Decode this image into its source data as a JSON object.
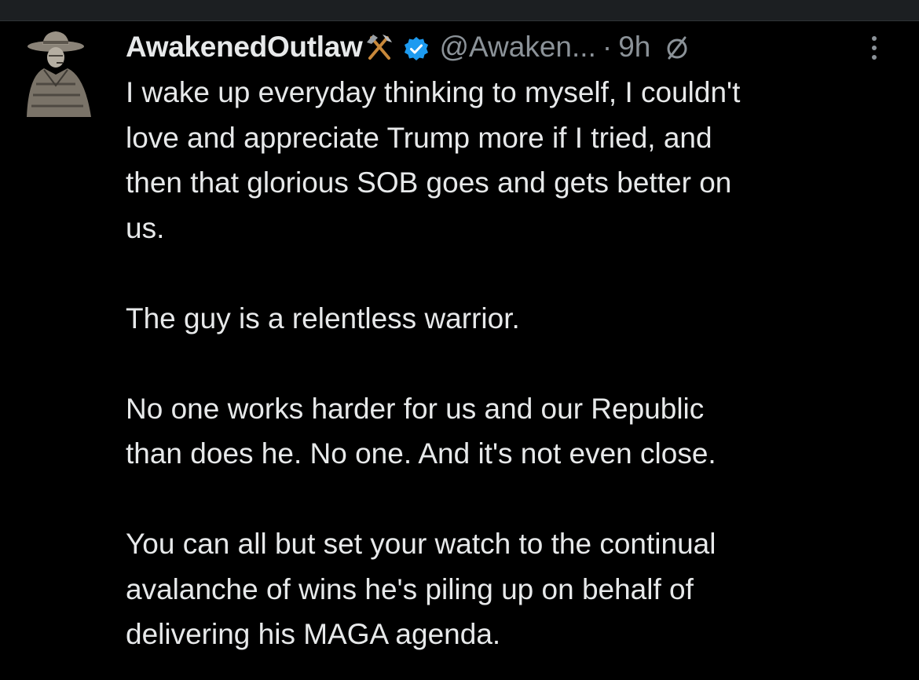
{
  "tweet": {
    "display_name": "AwakenedOutlaw",
    "name_emoji": "hammer-and-pick-icon",
    "verified_icon": "verified-badge-icon",
    "handle": "@Awaken...",
    "separator": "·",
    "time": "9h",
    "status_icon": "empty-set-icon",
    "more_icon": "more-vertical-icon",
    "paragraphs": [
      "I wake up everyday thinking to myself, I couldn't\nlove and appreciate Trump more if I tried, and\nthen that glorious SOB goes and gets better on\nus.",
      "The guy is a relentless warrior.",
      "No one works harder for us and our Republic\nthan does he.  No one.  And it's not even close.",
      "You can all but set your watch to the continual\navalanche of wins he's piling up on behalf of\ndelivering his MAGA agenda."
    ]
  },
  "colors": {
    "background": "#000000",
    "text": "#e7e9ea",
    "secondary": "#8b9298",
    "verified": "#1d9bf0",
    "top_strip": "#1c1f22"
  }
}
